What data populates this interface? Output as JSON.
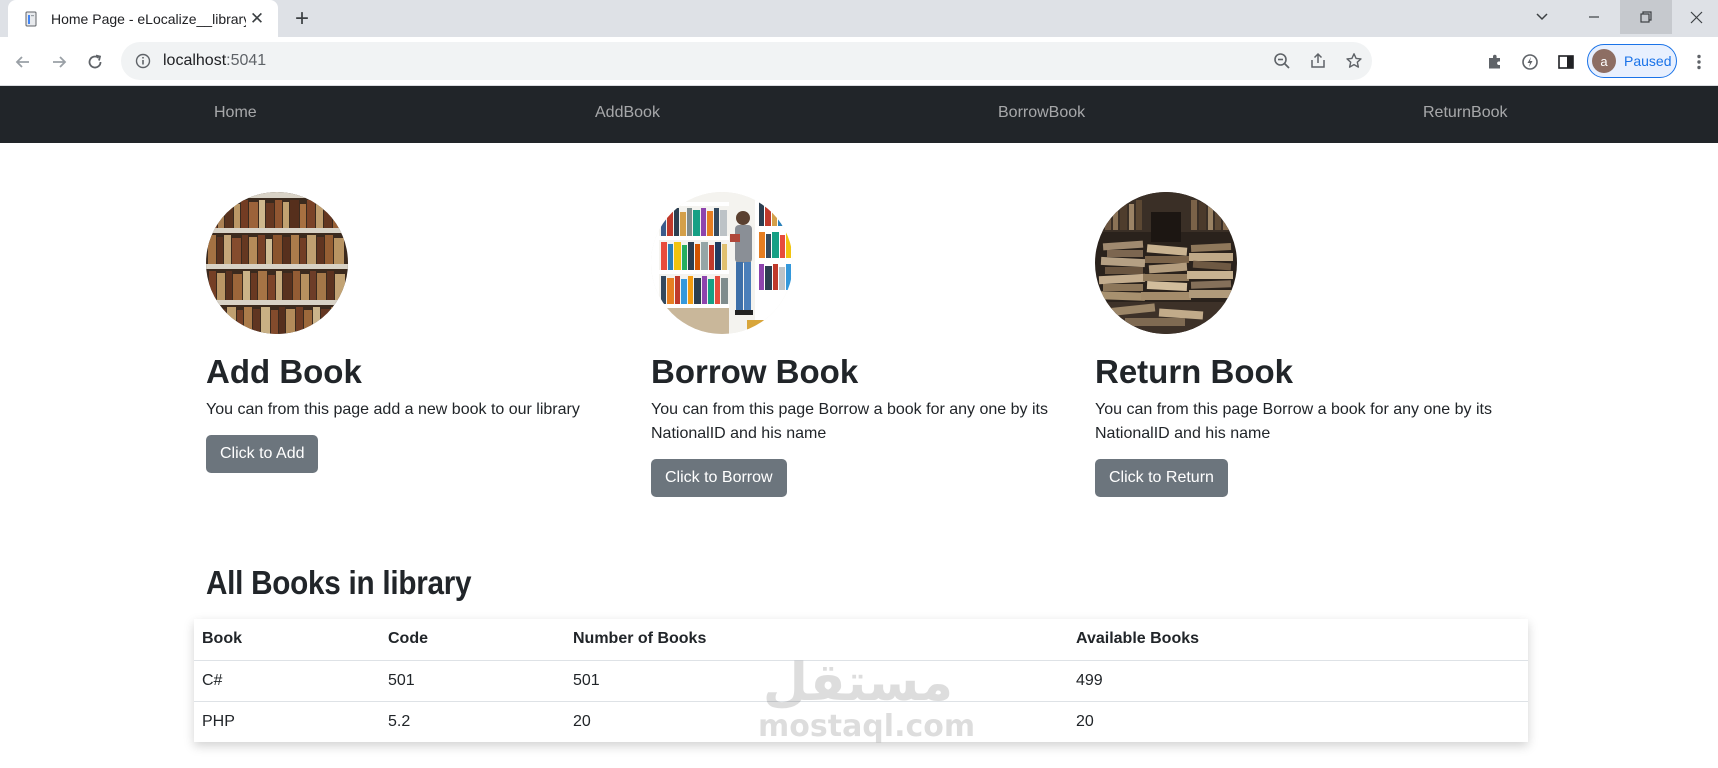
{
  "browser": {
    "tab_title": "Home Page - eLocalize__library",
    "tab_close": "✕",
    "new_tab": "+",
    "url_host": "localhost",
    "url_port": ":5041",
    "profile_initial": "a",
    "profile_status": "Paused"
  },
  "nav": {
    "items": [
      {
        "label": "Home"
      },
      {
        "label": "AddBook"
      },
      {
        "label": "BorrowBook"
      },
      {
        "label": "ReturnBook"
      }
    ]
  },
  "cards": [
    {
      "title": "Add Book",
      "text": "You can from this page add a new book to our library",
      "button": "Click to Add"
    },
    {
      "title": "Borrow Book",
      "text": "You can from this page Borrow a book for any one by its NationalID and his name",
      "button": "Click to Borrow"
    },
    {
      "title": "Return Book",
      "text": "You can from this page Borrow a book for any one by its NationalID and his name",
      "button": "Click to Return"
    }
  ],
  "books_section": {
    "title": "All Books in library",
    "columns": [
      "Book",
      "Code",
      "Number of Books",
      "Available Books"
    ],
    "rows": [
      [
        "C#",
        "501",
        "501",
        "499"
      ],
      [
        "PHP",
        "5.2",
        "20",
        "20"
      ]
    ]
  },
  "watermark": {
    "arabic": "مستقل",
    "latin": "mostaql.com"
  },
  "colors": {
    "navbar_bg": "#212529",
    "button_bg": "#6c757d",
    "accent": "#1a73e8"
  }
}
